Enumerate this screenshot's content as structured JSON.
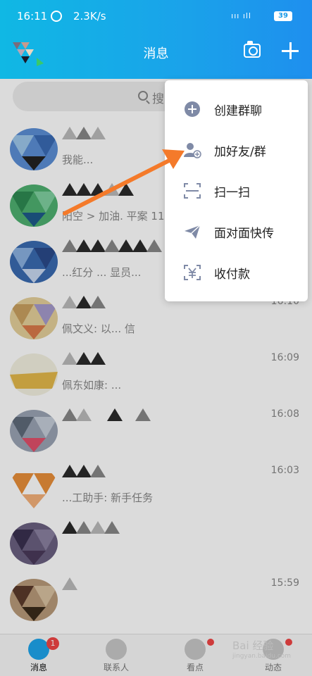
{
  "status_bar": {
    "time": "16:11",
    "speed": "2.3K/s",
    "signal": "ııı ıll",
    "battery": "39"
  },
  "header": {
    "title": "消息"
  },
  "search": {
    "placeholder": "搜"
  },
  "menu": {
    "items": [
      {
        "label": "创建群聊",
        "icon": "add-circle-icon"
      },
      {
        "label": "加好友/群",
        "icon": "add-friend-icon"
      },
      {
        "label": "扫一扫",
        "icon": "scan-icon"
      },
      {
        "label": "面对面快传",
        "icon": "paper-plane-icon"
      },
      {
        "label": "收付款",
        "icon": "payment-icon"
      }
    ]
  },
  "chats": [
    {
      "message": "我能...",
      "time": ""
    },
    {
      "message": "阳空 > 加油. 平案 11日",
      "time": ""
    },
    {
      "message": "...红分 ... 显员...",
      "time": ""
    },
    {
      "message": "佩文义: 以...          信",
      "time": "16:10"
    },
    {
      "message": "佩东如康: ...",
      "time": "16:09"
    },
    {
      "message": "",
      "time": "16:08"
    },
    {
      "message": "...工助手: 新手任务",
      "time": "16:03"
    },
    {
      "message": "",
      "time": ""
    },
    {
      "message": "",
      "time": "15:59"
    }
  ],
  "nav": {
    "items": [
      {
        "label": "消息",
        "badge": "1"
      },
      {
        "label": "联系人"
      },
      {
        "label": "看点"
      },
      {
        "label": "动态"
      }
    ]
  },
  "watermark": {
    "text": "Bai 经验",
    "sub": "jingyan.baidu.com"
  },
  "colors": {
    "accent": "#1aa2ea",
    "arrow": "#f47a2a",
    "badge": "#f04545"
  }
}
